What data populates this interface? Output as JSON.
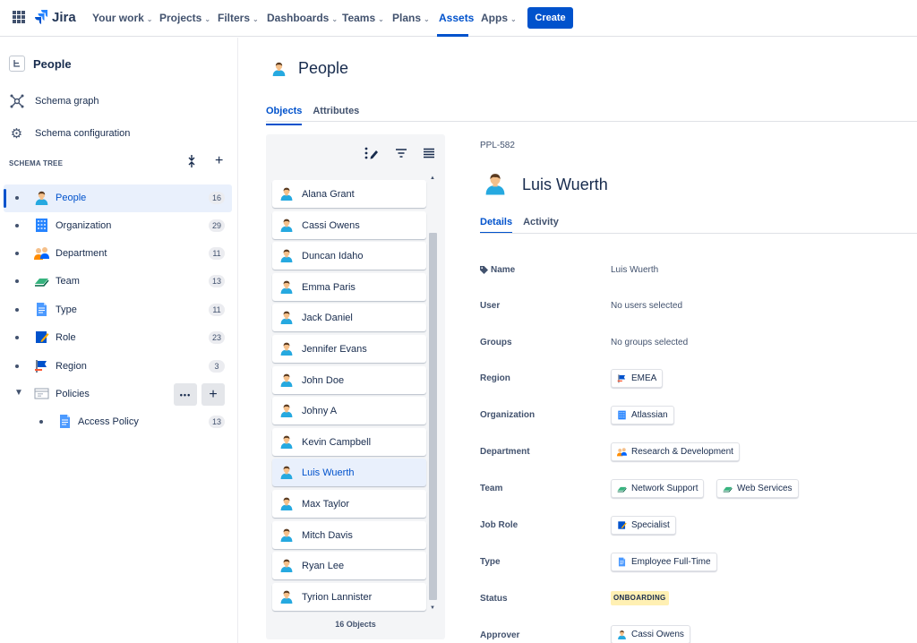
{
  "colors": {
    "brand": "#0052cc",
    "selected_bg": "#e9f0fc",
    "status_bg": "#fff0b3"
  },
  "app": {
    "name": "Jira"
  },
  "topnav": {
    "items": [
      "Your work",
      "Projects",
      "Filters",
      "Dashboards",
      "Teams",
      "Plans",
      "Assets",
      "Apps"
    ],
    "active": "Assets",
    "create_label": "Create"
  },
  "sidebar": {
    "schema_name": "People",
    "links": [
      {
        "label": "Schema graph",
        "icon": "schema-graph-icon"
      },
      {
        "label": "Schema configuration",
        "icon": "gear-icon"
      }
    ],
    "tree_title": "SCHEMA TREE",
    "tree": [
      {
        "label": "People",
        "count": "16",
        "icon": "person-icon",
        "selected": true
      },
      {
        "label": "Organization",
        "count": "29",
        "icon": "building-icon"
      },
      {
        "label": "Department",
        "count": "11",
        "icon": "group-icon"
      },
      {
        "label": "Team",
        "count": "13",
        "icon": "team-icon"
      },
      {
        "label": "Type",
        "count": "11",
        "icon": "document-icon"
      },
      {
        "label": "Role",
        "count": "23",
        "icon": "role-icon"
      },
      {
        "label": "Region",
        "count": "3",
        "icon": "flag-icon"
      },
      {
        "label": "Policies",
        "icon": "policy-icon",
        "expanded": true
      },
      {
        "label": "Access Policy",
        "count": "13",
        "icon": "document-icon",
        "child": true
      }
    ],
    "more_label": "•••",
    "add_label": "+"
  },
  "main": {
    "title": "People",
    "tabs": [
      "Objects",
      "Attributes"
    ]
  },
  "list": {
    "items": [
      "Alana Grant",
      "Cassi Owens",
      "Duncan Idaho",
      "Emma Paris",
      "Jack Daniel",
      "Jennifer Evans",
      "John Doe",
      "Johny A",
      "Kevin Campbell",
      "Luis Wuerth",
      "Max Taylor",
      "Mitch Davis",
      "Ryan Lee",
      "Tyrion Lannister"
    ],
    "selected": "Luis Wuerth",
    "footer": "16 Objects"
  },
  "detail": {
    "key": "PPL-582",
    "name": "Luis Wuerth",
    "tabs": [
      "Details",
      "Activity"
    ],
    "attributes": {
      "name_label": "Name",
      "name_value": "Luis Wuerth",
      "user_label": "User",
      "user_value": "No users selected",
      "groups_label": "Groups",
      "groups_value": "No groups selected",
      "region_label": "Region",
      "region_value": "EMEA",
      "org_label": "Organization",
      "org_value": "Atlassian",
      "dept_label": "Department",
      "dept_value": "Research & Development",
      "team_label": "Team",
      "team_values": [
        "Network Support",
        "Web Services"
      ],
      "jobrole_label": "Job Role",
      "jobrole_value": "Specialist",
      "type_label": "Type",
      "type_value": "Employee Full-Time",
      "status_label": "Status",
      "status_value": "ONBOARDING",
      "approver_label": "Approver",
      "approver_value": "Cassi Owens"
    }
  }
}
